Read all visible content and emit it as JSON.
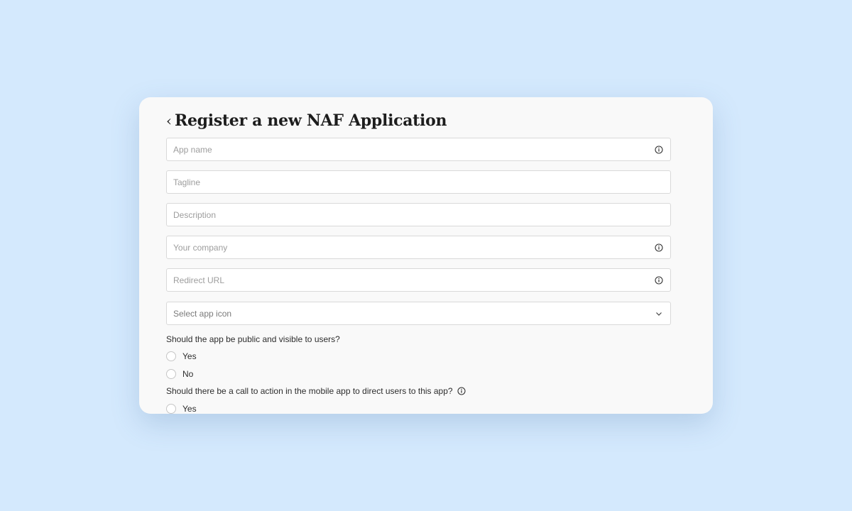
{
  "header": {
    "back_symbol": "‹",
    "title": "Register a new NAF Application"
  },
  "form": {
    "app_name_placeholder": "App name",
    "tagline_placeholder": "Tagline",
    "description_placeholder": "Description",
    "company_placeholder": "Your company",
    "redirect_url_placeholder": "Redirect URL",
    "app_icon_select": "Select app icon"
  },
  "questions": {
    "public_visible": {
      "label": "Should the app be public and visible to users?",
      "options": [
        "Yes",
        "No"
      ]
    },
    "call_to_action": {
      "label": "Should there be a call to action in the mobile app to direct users to this app?",
      "options": [
        "Yes"
      ]
    }
  },
  "icons": {
    "info": "info-circle-icon",
    "dropdown": "chevron-down-icon",
    "back": "chevron-left-icon"
  },
  "colors": {
    "background": "#d4e9fd",
    "card": "#f9f9f9",
    "text": "#1d1d1d",
    "border": "#d9d9d9"
  }
}
